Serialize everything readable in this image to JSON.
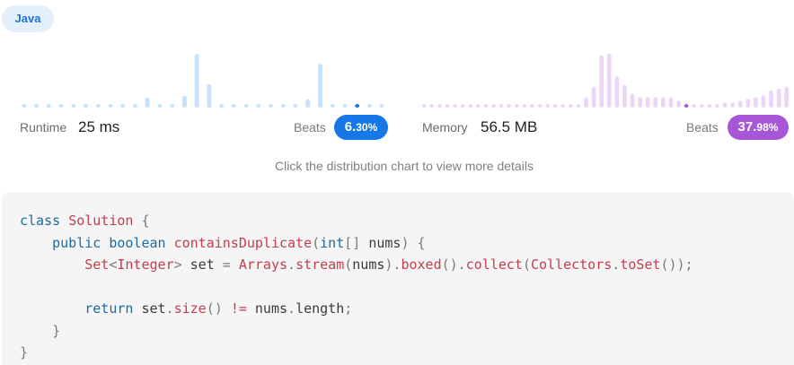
{
  "language_tag": "Java",
  "runtime": {
    "label": "Runtime",
    "value": "25 ms",
    "beats_label": "Beats",
    "beats_main": "6.",
    "beats_frac": "30%",
    "chart_data": {
      "type": "bar",
      "values": [
        2,
        2,
        2,
        2,
        2,
        2,
        2,
        2,
        2,
        2,
        6,
        2,
        2,
        7,
        32,
        14,
        2,
        2,
        2,
        2,
        2,
        2,
        2,
        5,
        26,
        2,
        2,
        2,
        2,
        2
      ],
      "highlight_index": 27,
      "color": "#c9e2fb",
      "highlight_color": "#1677e6"
    }
  },
  "memory": {
    "label": "Memory",
    "value": "56.5 MB",
    "beats_label": "Beats",
    "beats_main": "37.",
    "beats_frac": "98%",
    "chart_data": {
      "type": "bar",
      "values": [
        2,
        2,
        2,
        2,
        2,
        2,
        2,
        2,
        2,
        2,
        2,
        2,
        2,
        2,
        2,
        2,
        2,
        2,
        2,
        2,
        2,
        6,
        12,
        30,
        31,
        18,
        13,
        8,
        6,
        6,
        6,
        6,
        6,
        4,
        2,
        2,
        2,
        2,
        2,
        3,
        3,
        4,
        5,
        6,
        7,
        10,
        11,
        12
      ],
      "highlight_index": 34,
      "color": "#ecd6f6",
      "highlight_color": "#a557d6"
    }
  },
  "hint": "Click the distribution chart to view more details",
  "code": {
    "line1": [
      "class",
      " ",
      "Solution",
      " {"
    ],
    "line2": [
      "public",
      " ",
      "boolean",
      " ",
      "containsDuplicate",
      "(",
      "int",
      "[] ",
      "nums",
      ") {"
    ],
    "line3": [
      "Set",
      "<",
      "Integer",
      "> ",
      "set",
      " = ",
      "Arrays",
      ".",
      "stream",
      "(",
      "nums",
      ").",
      "boxed",
      "().",
      "collect",
      "(",
      "Collectors",
      ".",
      "toSet",
      "());"
    ],
    "line5": [
      "return",
      " ",
      "set",
      ".",
      "size",
      "() ",
      "!=",
      " ",
      "nums",
      ".",
      "length",
      ";"
    ],
    "line6": "}",
    "line7": "}"
  }
}
